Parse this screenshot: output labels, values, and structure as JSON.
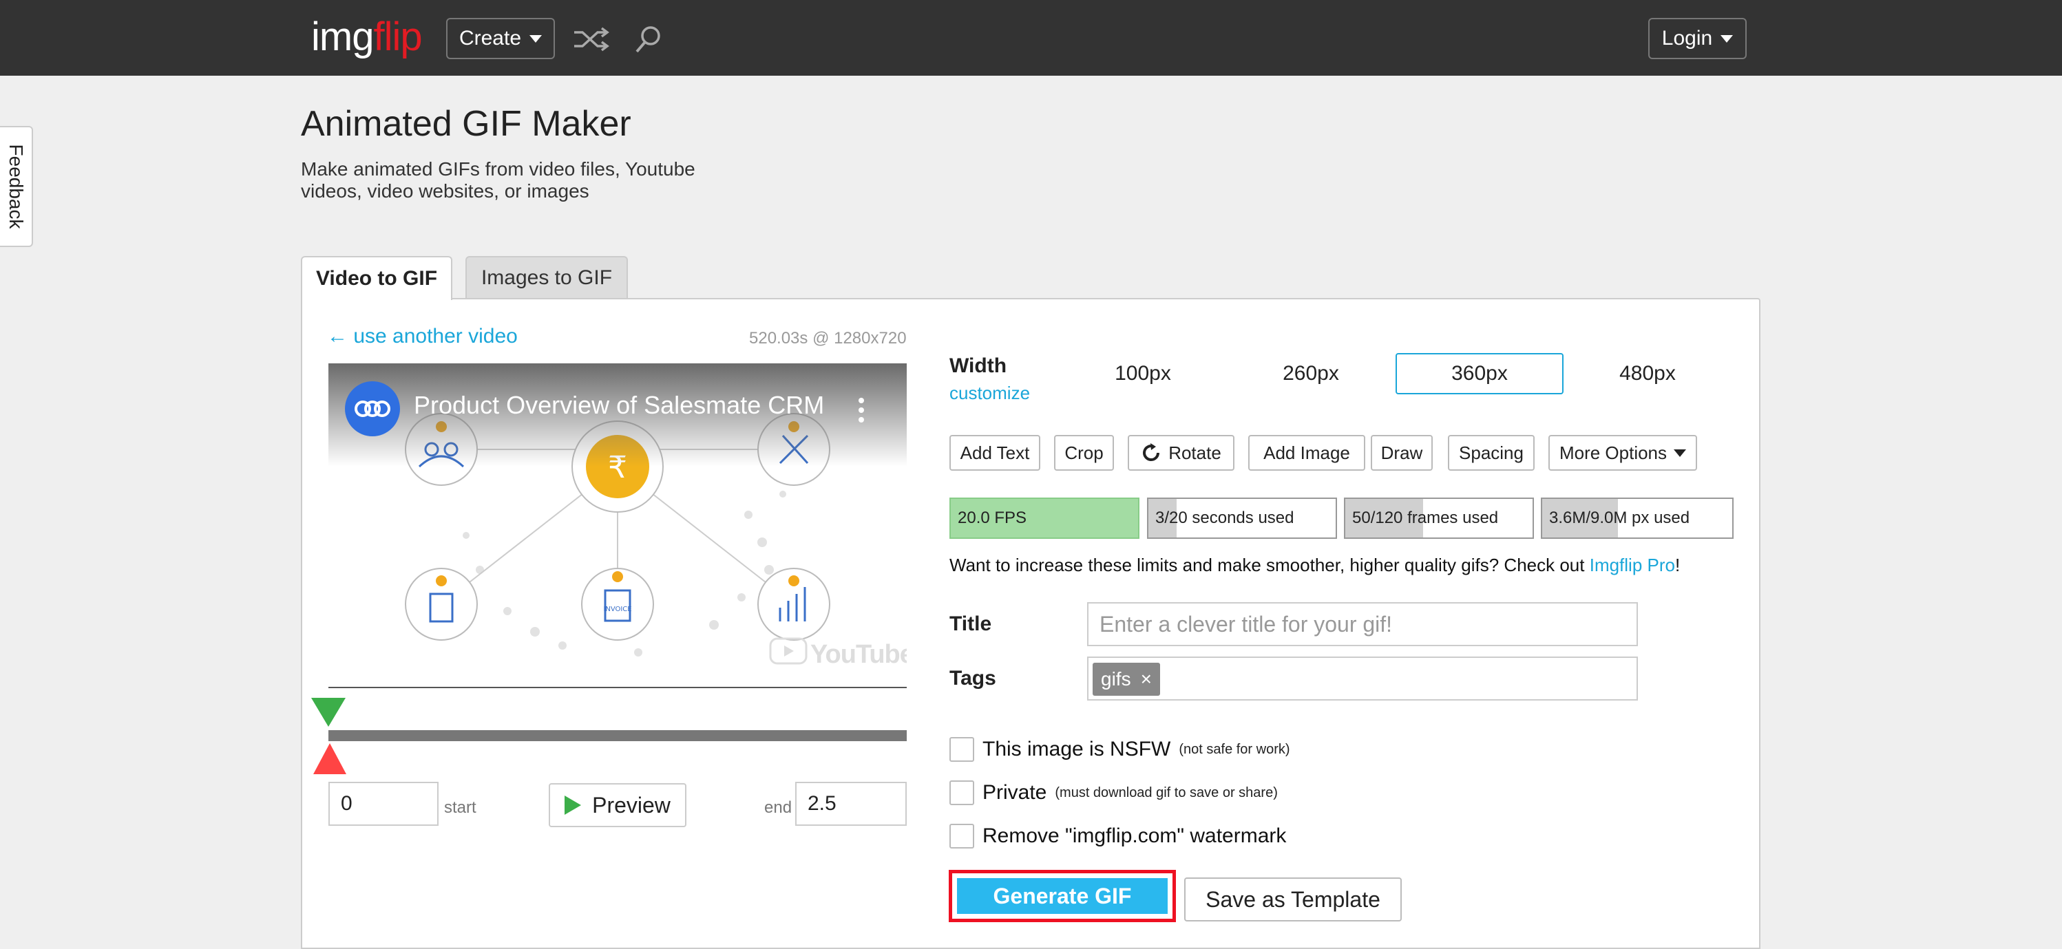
{
  "header": {
    "logo_part1": "img",
    "logo_part2": "flip",
    "create_label": "Create",
    "login_label": "Login",
    "icons": [
      "shuffle-icon",
      "search-icon"
    ]
  },
  "feedback_label": "Feedback",
  "page": {
    "title": "Animated GIF Maker",
    "subtitle": "Make animated GIFs from video files, Youtube videos, video websites, or images"
  },
  "tabs": [
    {
      "label": "Video to GIF",
      "active": true
    },
    {
      "label": "Images to GIF",
      "active": false
    }
  ],
  "video": {
    "another_link": "← use another video",
    "info": "520.03s @ 1280x720",
    "title": "Product Overview of Salesmate CRM",
    "youtube_label": "YouTube",
    "start_value": "0",
    "start_label": "start",
    "preview_label": "Preview",
    "end_label": "end",
    "end_value": "2.5"
  },
  "width": {
    "label": "Width",
    "customize": "customize",
    "options": [
      "100px",
      "260px",
      "360px",
      "480px"
    ],
    "selected": "360px"
  },
  "tools": [
    "Add Text",
    "Crop",
    "Rotate",
    "Add Image",
    "Draw",
    "Spacing",
    "More Options"
  ],
  "stats": {
    "fps": "20.0 FPS",
    "seconds": "3/20 seconds used",
    "seconds_fraction": 0.15,
    "frames": "50/120 frames used",
    "frames_fraction": 0.4167,
    "pixels": "3.6M/9.0M px used",
    "pixels_fraction": 0.4
  },
  "limits": {
    "text": "Want to increase these limits and make smoother, higher quality gifs? Check out ",
    "link": "Imgflip Pro",
    "suffix": "!"
  },
  "form": {
    "title_label": "Title",
    "title_placeholder": "Enter a clever title for your gif!",
    "tags_label": "Tags",
    "tag": "gifs",
    "tag_remove": "×",
    "nsfw_label": "This image is NSFW",
    "nsfw_note": "(not safe for work)",
    "private_label": "Private",
    "private_note": "(must download gif to save or share)",
    "watermark_label": "Remove \"imgflip.com\" watermark"
  },
  "actions": {
    "generate": "Generate GIF",
    "template": "Save as Template"
  },
  "colors": {
    "accent": "#1aa6d9",
    "generate_bg": "#2ab8ee",
    "highlight": "#ee1122",
    "logo_red": "#e31b23",
    "fps_green": "#a3dca3"
  }
}
